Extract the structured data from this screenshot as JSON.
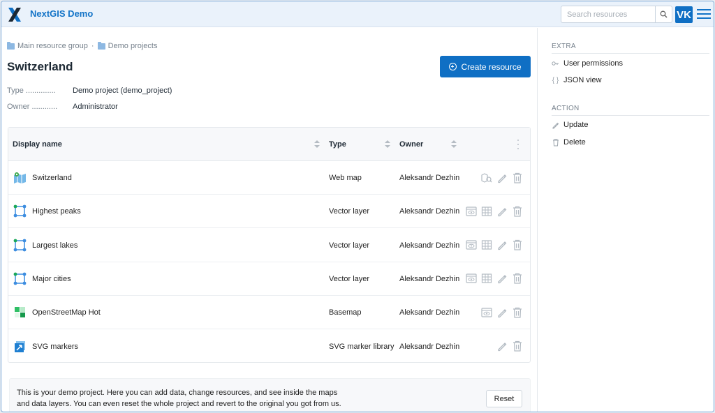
{
  "header": {
    "app_title": "NextGIS Demo",
    "search_placeholder": "Search resources",
    "avatar_initials": "VK",
    "brand_color": "#0f6fc4"
  },
  "breadcrumb": [
    {
      "label": "Main resource group"
    },
    {
      "label": "Demo projects"
    }
  ],
  "page": {
    "title": "Switzerland",
    "create_button": "Create resource",
    "meta": [
      {
        "key": "Type ..............",
        "value": "Demo project (demo_project)"
      },
      {
        "key": "Owner ............",
        "value": "Administrator"
      }
    ]
  },
  "table": {
    "columns": [
      "Display name",
      "Type",
      "Owner"
    ],
    "rows": [
      {
        "name": "Switzerland",
        "type": "Web map",
        "owner": "Aleksandr Dezhin",
        "icon": "webmap-icon",
        "actions": [
          "map-preview-icon",
          "edit-icon",
          "delete-icon"
        ]
      },
      {
        "name": "Highest peaks",
        "type": "Vector layer",
        "owner": "Aleksandr Dezhin",
        "icon": "vector-layer-icon",
        "actions": [
          "preview-icon",
          "table-icon",
          "edit-icon",
          "delete-icon"
        ]
      },
      {
        "name": "Largest lakes",
        "type": "Vector layer",
        "owner": "Aleksandr Dezhin",
        "icon": "vector-layer-icon",
        "actions": [
          "preview-icon",
          "table-icon",
          "edit-icon",
          "delete-icon"
        ]
      },
      {
        "name": "Major cities",
        "type": "Vector layer",
        "owner": "Aleksandr Dezhin",
        "icon": "vector-layer-icon",
        "actions": [
          "preview-icon",
          "table-icon",
          "edit-icon",
          "delete-icon"
        ]
      },
      {
        "name": "OpenStreetMap Hot",
        "type": "Basemap",
        "owner": "Aleksandr Dezhin",
        "icon": "basemap-icon",
        "actions": [
          "preview-icon",
          "edit-icon",
          "delete-icon"
        ]
      },
      {
        "name": "SVG markers",
        "type": "SVG marker library",
        "owner": "Aleksandr Dezhin",
        "icon": "svg-marker-library-icon",
        "actions": [
          "edit-icon",
          "delete-icon"
        ]
      }
    ]
  },
  "notice": {
    "text": "This is your demo project. Here you can add data, change resources, and see inside the maps and data layers. You can even reset the whole project and revert to the original you got from us.",
    "reset_button": "Reset"
  },
  "sidebar": {
    "sections": [
      {
        "title": "EXTRA",
        "items": [
          {
            "label": "User permissions",
            "icon": "key-icon"
          },
          {
            "label": "JSON view",
            "icon": "braces-icon"
          }
        ]
      },
      {
        "title": "ACTION",
        "items": [
          {
            "label": "Update",
            "icon": "pencil-icon"
          },
          {
            "label": "Delete",
            "icon": "trash-icon"
          }
        ]
      }
    ]
  }
}
